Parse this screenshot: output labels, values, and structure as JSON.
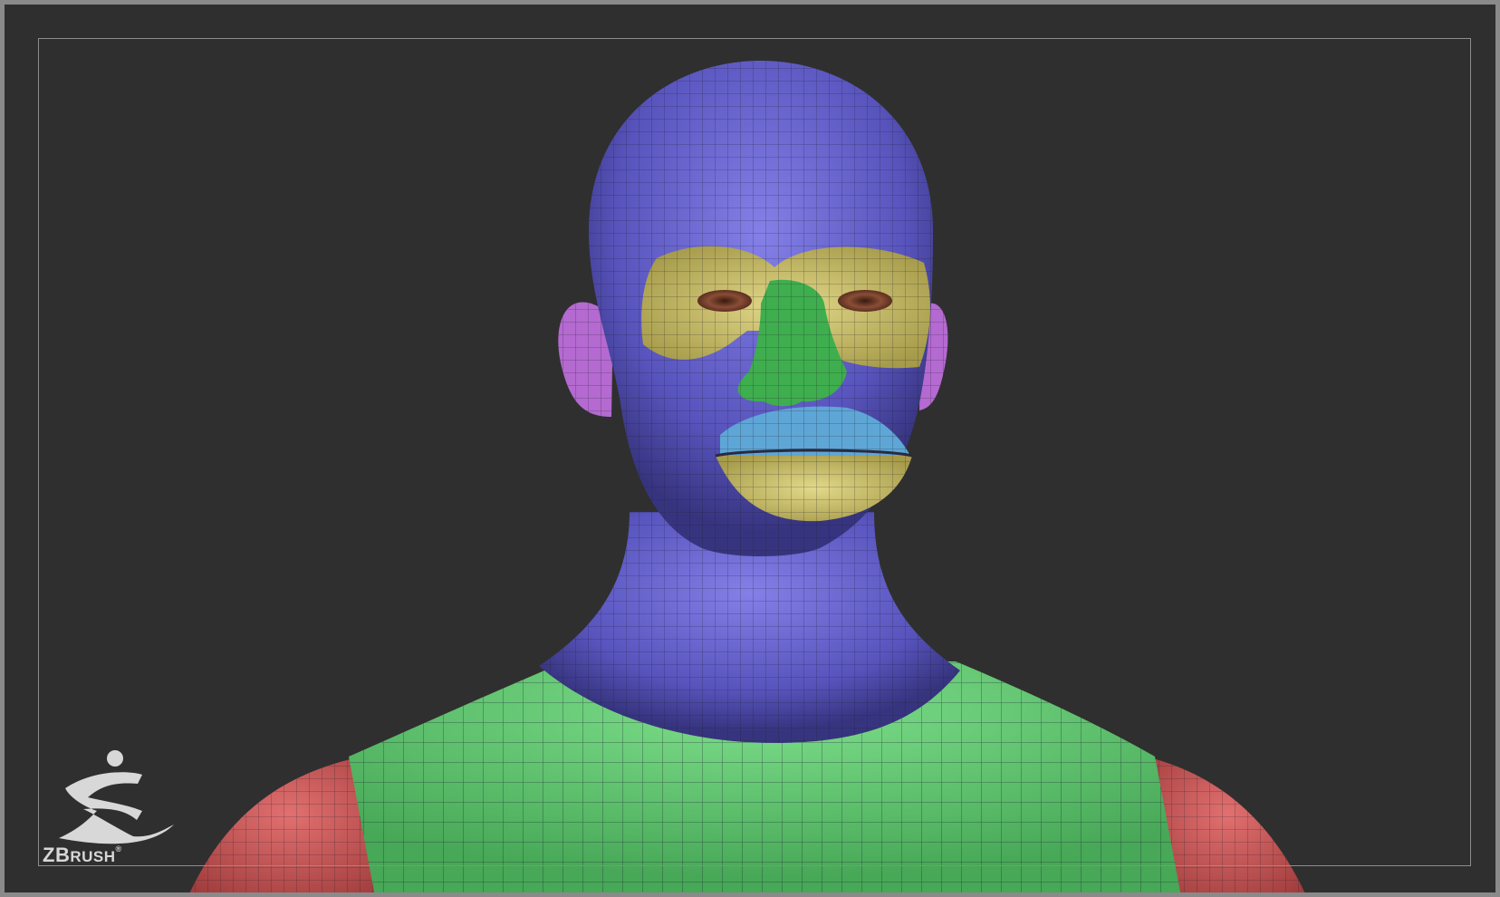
{
  "viewport": {
    "background_color": "#2f2f2f",
    "frame_color": "#8a8a8a"
  },
  "model": {
    "polygroups": [
      {
        "name": "head",
        "color": "#5f5cc8"
      },
      {
        "name": "eye-sockets",
        "color": "#c9c06a"
      },
      {
        "name": "nose",
        "color": "#3fae4e"
      },
      {
        "name": "upper-lip",
        "color": "#5ea6d6"
      },
      {
        "name": "lower-lip-chin",
        "color": "#d4c275"
      },
      {
        "name": "ears",
        "color": "#b46ad0"
      },
      {
        "name": "chest",
        "color": "#5ccb6f"
      },
      {
        "name": "shoulders",
        "color": "#d55e5e"
      }
    ]
  },
  "logo": {
    "icon": "zbrush-figure-icon",
    "text_big": "ZB",
    "text_small": "RUSH",
    "mark": "®"
  }
}
